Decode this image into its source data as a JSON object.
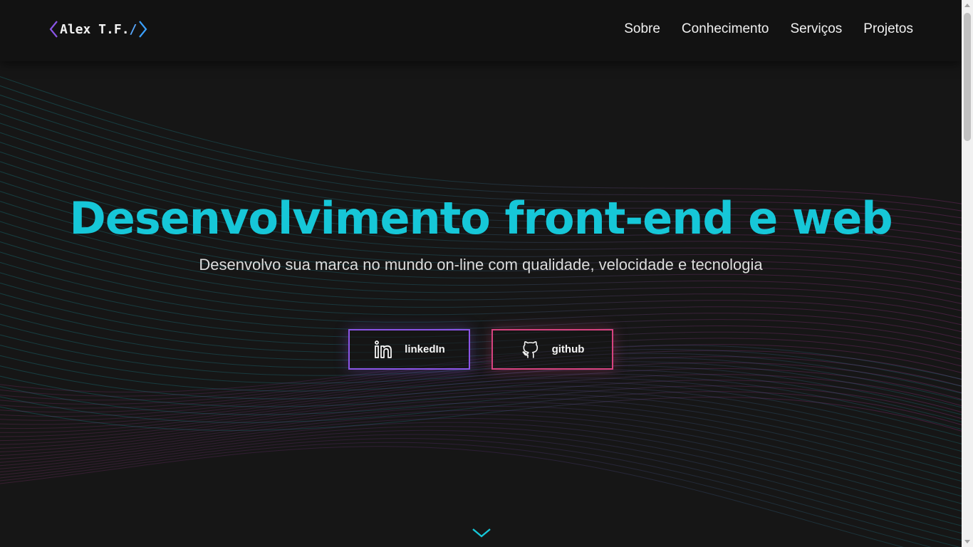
{
  "header": {
    "logo_text": "Alex T.F.",
    "logo_slash": "/",
    "nav": [
      "Sobre",
      "Conhecimento",
      "Serviços",
      "Projetos"
    ]
  },
  "hero": {
    "headline": "Desenvolvimento front-end e web",
    "subtitle": "Desenvolvo sua marca no mundo on-line com qualidade, velocidade e tecnologia",
    "buttons": [
      {
        "label": "linkedIn",
        "icon": "linkedin-icon"
      },
      {
        "label": "github",
        "icon": "github-icon"
      }
    ],
    "scroll_icon": "chevron-down-icon"
  },
  "colors": {
    "background": "#161616",
    "navbar": "#121212",
    "headline": "#16c7d8",
    "linkedin_border": "#8a55e6",
    "github_border": "#d6437f",
    "logo_bracket_start": "#8a55e6",
    "logo_bracket_end": "#3aa0ff"
  }
}
